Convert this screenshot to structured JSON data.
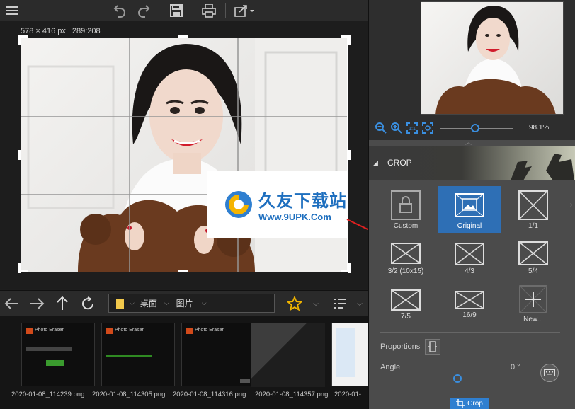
{
  "toolbar": {
    "icons": [
      "menu-icon",
      "undo-icon",
      "redo-icon",
      "save-icon",
      "print-icon",
      "share-icon"
    ]
  },
  "canvas": {
    "dimensions_label": "578 × 416 px | 289:208"
  },
  "watermark": {
    "title": "久友下载站",
    "subtitle": "Www.9UPK.Com"
  },
  "navbar": {
    "breadcrumb": [
      "桌面",
      "图片"
    ]
  },
  "filmstrip": {
    "items": [
      {
        "label": "2020-01-08_114239.png"
      },
      {
        "label": "2020-01-08_114305.png"
      },
      {
        "label": "2020-01-08_114316.png"
      },
      {
        "label": "2020-01-08_114357.png"
      },
      {
        "label": "2020-01-"
      }
    ],
    "thumb_title": "Photo Eraser"
  },
  "preview": {
    "zoom_value": "98.1%",
    "zoom_fraction": 0.48
  },
  "crop": {
    "section_title": "CROP",
    "options": [
      {
        "label": "Custom",
        "selected": false
      },
      {
        "label": "Original",
        "selected": true
      },
      {
        "label": "1/1",
        "selected": false
      },
      {
        "label": "3/2 (10x15)",
        "selected": false
      },
      {
        "label": "4/3",
        "selected": false
      },
      {
        "label": "5/4",
        "selected": false
      },
      {
        "label": "7/5",
        "selected": false
      },
      {
        "label": "16/9",
        "selected": false
      },
      {
        "label": "New...",
        "selected": false
      }
    ],
    "proportions_label": "Proportions",
    "angle_label": "Angle",
    "angle_value": "0 °",
    "angle_fraction": 0.5,
    "crop_button": "Crop"
  },
  "colors": {
    "accent": "#2f7fd0",
    "selected_tile": "#2e6fb5"
  }
}
